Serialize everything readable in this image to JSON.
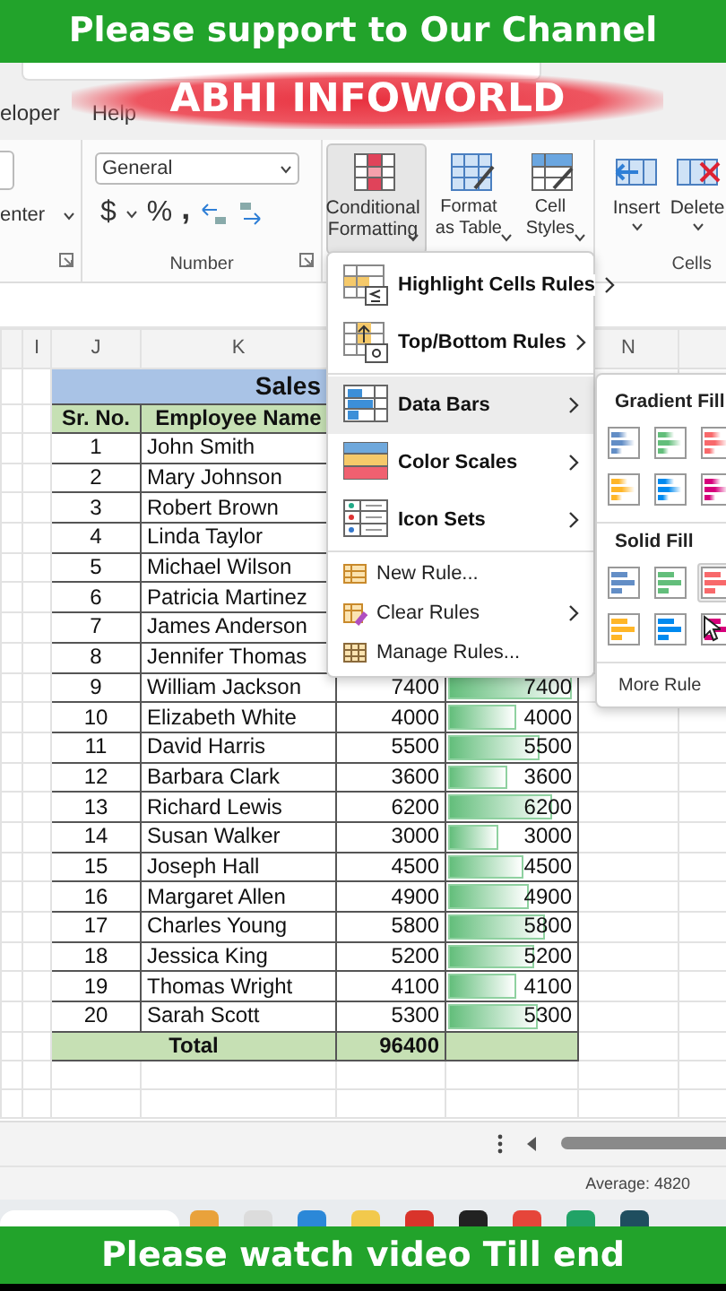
{
  "banner_top": "Please support to Our Channel",
  "channel_banner": "ABHI INFOWORLD",
  "tabs": [
    "eloper",
    "Help"
  ],
  "ribbon": {
    "alignment_label": "enter",
    "number_format": "General",
    "number_symbols": [
      "$",
      "%",
      ","
    ],
    "number_group": "Number",
    "styles_buttons": [
      {
        "label": "Conditional Formatting",
        "kind": "conditional",
        "selected": true
      },
      {
        "label": "Format as Table",
        "kind": "table",
        "selected": false
      },
      {
        "label": "Cell Styles",
        "kind": "styles",
        "selected": false
      }
    ],
    "cells_buttons": [
      {
        "label": "Insert",
        "kind": "insert"
      },
      {
        "label": "Delete",
        "kind": "delete"
      }
    ],
    "cells_group": "Cells"
  },
  "column_headers": [
    "I",
    "J",
    "K",
    "N"
  ],
  "sheet": {
    "title": "Sales",
    "headers": [
      "Sr. No.",
      "Employee Name"
    ],
    "rows": [
      {
        "sr": "1",
        "name": "John Smith"
      },
      {
        "sr": "2",
        "name": "Mary Johnson"
      },
      {
        "sr": "3",
        "name": "Robert Brown"
      },
      {
        "sr": "4",
        "name": "Linda Taylor"
      },
      {
        "sr": "5",
        "name": "Michael Wilson"
      },
      {
        "sr": "6",
        "name": "Patricia Martinez"
      },
      {
        "sr": "7",
        "name": "James Anderson"
      },
      {
        "sr": "8",
        "name": "Jennifer Thomas"
      },
      {
        "sr": "9",
        "name": "William Jackson",
        "amount": "7400",
        "bar_value": "7400",
        "level": 0.97
      },
      {
        "sr": "10",
        "name": "Elizabeth White",
        "amount": "4000",
        "bar_value": "4000",
        "level": 0.53
      },
      {
        "sr": "11",
        "name": "David Harris",
        "amount": "5500",
        "bar_value": "5500",
        "level": 0.72
      },
      {
        "sr": "12",
        "name": "Barbara Clark",
        "amount": "3600",
        "bar_value": "3600",
        "level": 0.47
      },
      {
        "sr": "13",
        "name": "Richard Lewis",
        "amount": "6200",
        "bar_value": "6200",
        "level": 0.82
      },
      {
        "sr": "14",
        "name": "Susan Walker",
        "amount": "3000",
        "bar_value": "3000",
        "level": 0.39
      },
      {
        "sr": "15",
        "name": "Joseph Hall",
        "amount": "4500",
        "bar_value": "4500",
        "level": 0.59
      },
      {
        "sr": "16",
        "name": "Margaret Allen",
        "amount": "4900",
        "bar_value": "4900",
        "level": 0.64
      },
      {
        "sr": "17",
        "name": "Charles Young",
        "amount": "5800",
        "bar_value": "5800",
        "level": 0.76
      },
      {
        "sr": "18",
        "name": "Jessica King",
        "amount": "5200",
        "bar_value": "5200",
        "level": 0.68
      },
      {
        "sr": "19",
        "name": "Thomas Wright",
        "amount": "4100",
        "bar_value": "4100",
        "level": 0.54
      },
      {
        "sr": "20",
        "name": "Sarah Scott",
        "amount": "5300",
        "bar_value": "5300",
        "level": 0.7
      }
    ],
    "total": {
      "label": "Total",
      "amount": "96400"
    }
  },
  "menu": {
    "items": [
      {
        "label": "Highlight Cells Rules",
        "kind": "highlight",
        "submenu": true,
        "separator_before": false,
        "selected": false
      },
      {
        "label": "Top/Bottom Rules",
        "kind": "topbottom",
        "submenu": true,
        "separator_before": false,
        "selected": false
      },
      {
        "label": "Data Bars",
        "kind": "databars",
        "submenu": true,
        "separator_before": true,
        "selected": true
      },
      {
        "label": "Color Scales",
        "kind": "colorscales",
        "submenu": true,
        "separator_before": false,
        "selected": false
      },
      {
        "label": "Icon Sets",
        "kind": "iconsets",
        "submenu": true,
        "separator_before": false,
        "selected": false
      },
      {
        "label": "New Rule...",
        "kind": "newrule",
        "submenu": false,
        "separator_before": true,
        "selected": false
      },
      {
        "label": "Clear Rules",
        "kind": "clearrules",
        "submenu": true,
        "separator_before": false,
        "selected": false
      },
      {
        "label": "Manage Rules...",
        "kind": "managerules",
        "submenu": false,
        "separator_before": false,
        "selected": false
      }
    ]
  },
  "submenu": {
    "sections": [
      {
        "title": "Gradient Fill",
        "kind": "gradient",
        "swatches": [
          {
            "color": "#638ec6",
            "selected": false
          },
          {
            "color": "#63be7b",
            "selected": false
          },
          {
            "color": "#f8696b",
            "selected": false
          },
          {
            "color": "#ffb628",
            "selected": false
          },
          {
            "color": "#008aef",
            "selected": false
          },
          {
            "color": "#d6007b",
            "selected": false
          }
        ]
      },
      {
        "title": "Solid Fill",
        "kind": "solid",
        "swatches": [
          {
            "color": "#638ec6",
            "selected": false
          },
          {
            "color": "#63be7b",
            "selected": false
          },
          {
            "color": "#f8696b",
            "selected": true
          },
          {
            "color": "#ffb628",
            "selected": false
          },
          {
            "color": "#008aef",
            "selected": false
          },
          {
            "color": "#d6007b",
            "selected": false
          }
        ]
      }
    ],
    "footer": "More Rule"
  },
  "status": {
    "average": "Average: 4820"
  },
  "banner_bottom": "Please watch video Till end"
}
